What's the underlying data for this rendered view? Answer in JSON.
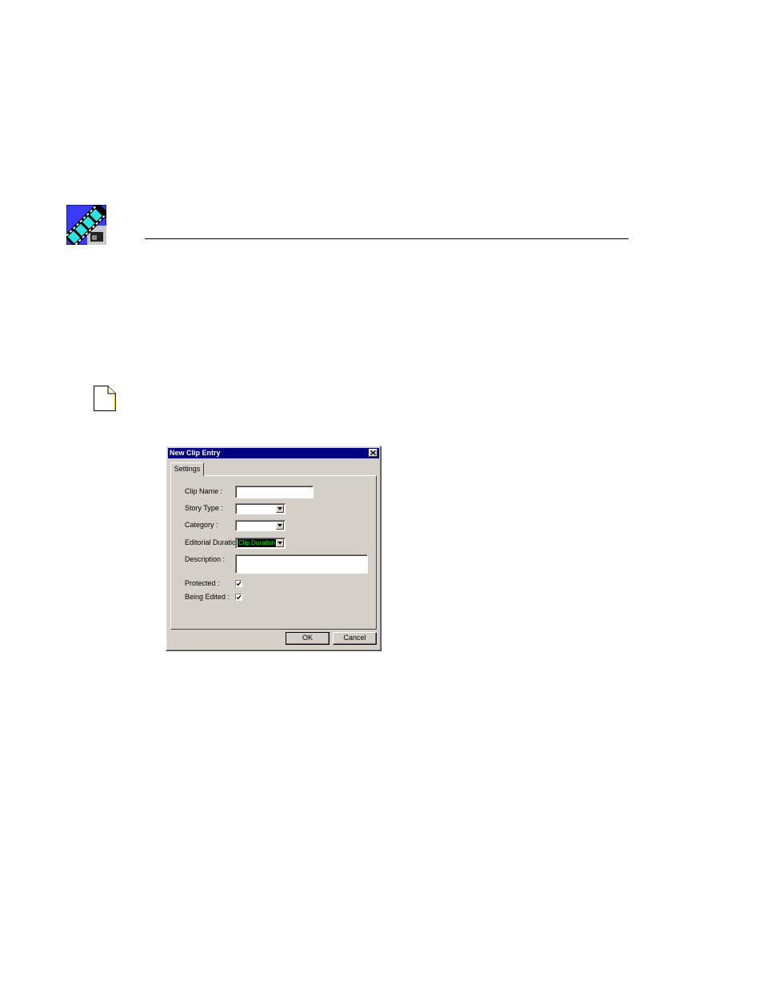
{
  "page": {
    "header_icon": "film-strip-logo-icon",
    "note_icon": "note-page-icon"
  },
  "dialog": {
    "title": "New Clip Entry",
    "close_icon": "close-icon",
    "tab_label": "Settings",
    "fields": {
      "clip_name_label": "Clip Name :",
      "clip_name_value": "",
      "story_type_label": "Story Type :",
      "story_type_value": "",
      "category_label": "Category :",
      "category_value": "",
      "editorial_duration_label": "Editorial Duration :",
      "editorial_duration_value": "Clip Duration",
      "description_label": "Description :",
      "description_value": "",
      "protected_label": "Protected :",
      "protected_checked": true,
      "being_edited_label": "Being Edited :",
      "being_edited_checked": true
    },
    "buttons": {
      "ok": "OK",
      "cancel": "Cancel"
    },
    "colors": {
      "titlebar": "#000080",
      "face": "#d4d0c8",
      "selected_value_bg": "#000000",
      "selected_value_fg": "#00ff00"
    }
  }
}
